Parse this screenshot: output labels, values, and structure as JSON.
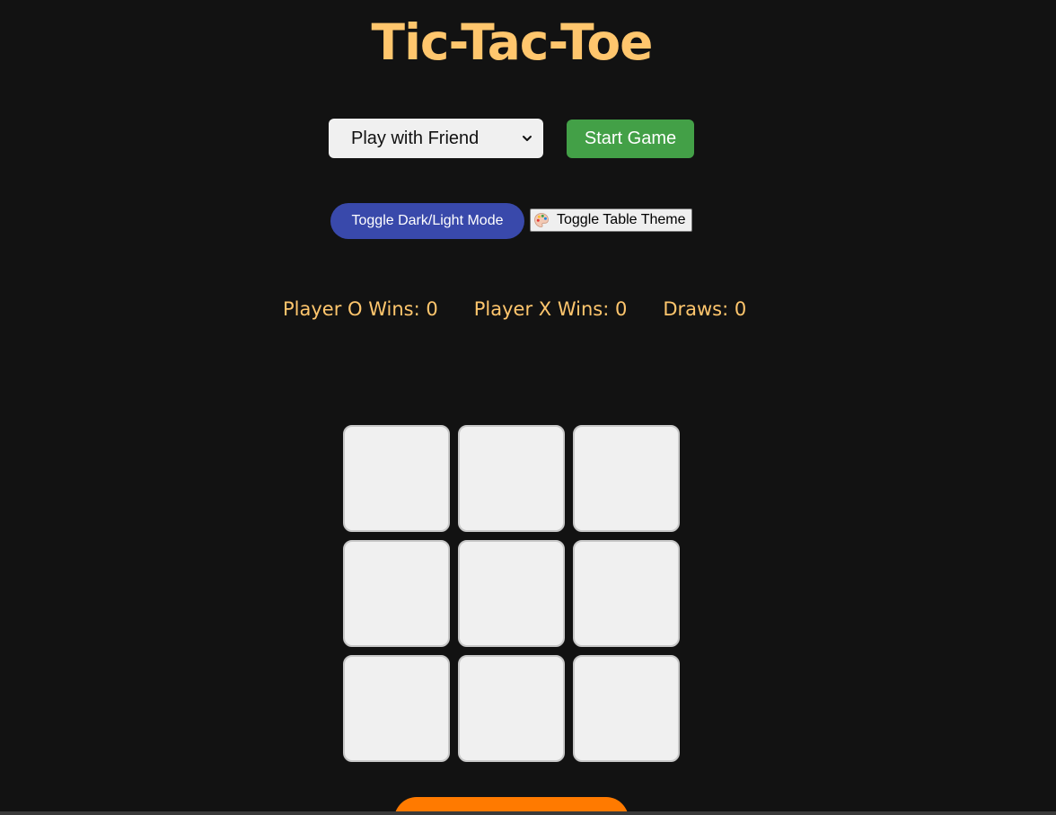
{
  "title": "Tic-Tac-Toe",
  "controls": {
    "mode_select_value": "Play with Friend",
    "start_label": "Start Game",
    "toggle_mode_label": "Toggle Dark/Light Mode",
    "toggle_theme_label": "Toggle Table Theme",
    "toggle_theme_icon": "palette-icon"
  },
  "scores": {
    "o_wins": "Player O Wins: 0",
    "x_wins": "Player X Wins: 0",
    "draws": "Draws: 0"
  },
  "board": {
    "cells": [
      "",
      "",
      "",
      "",
      "",
      "",
      "",
      "",
      ""
    ]
  },
  "colors": {
    "background": "#121212",
    "accent": "#ffc66d",
    "start_button": "#43a047",
    "toggle_mode_button": "#3949ab",
    "reset_button": "#ff7a00",
    "cell": "#f0f0f0"
  }
}
